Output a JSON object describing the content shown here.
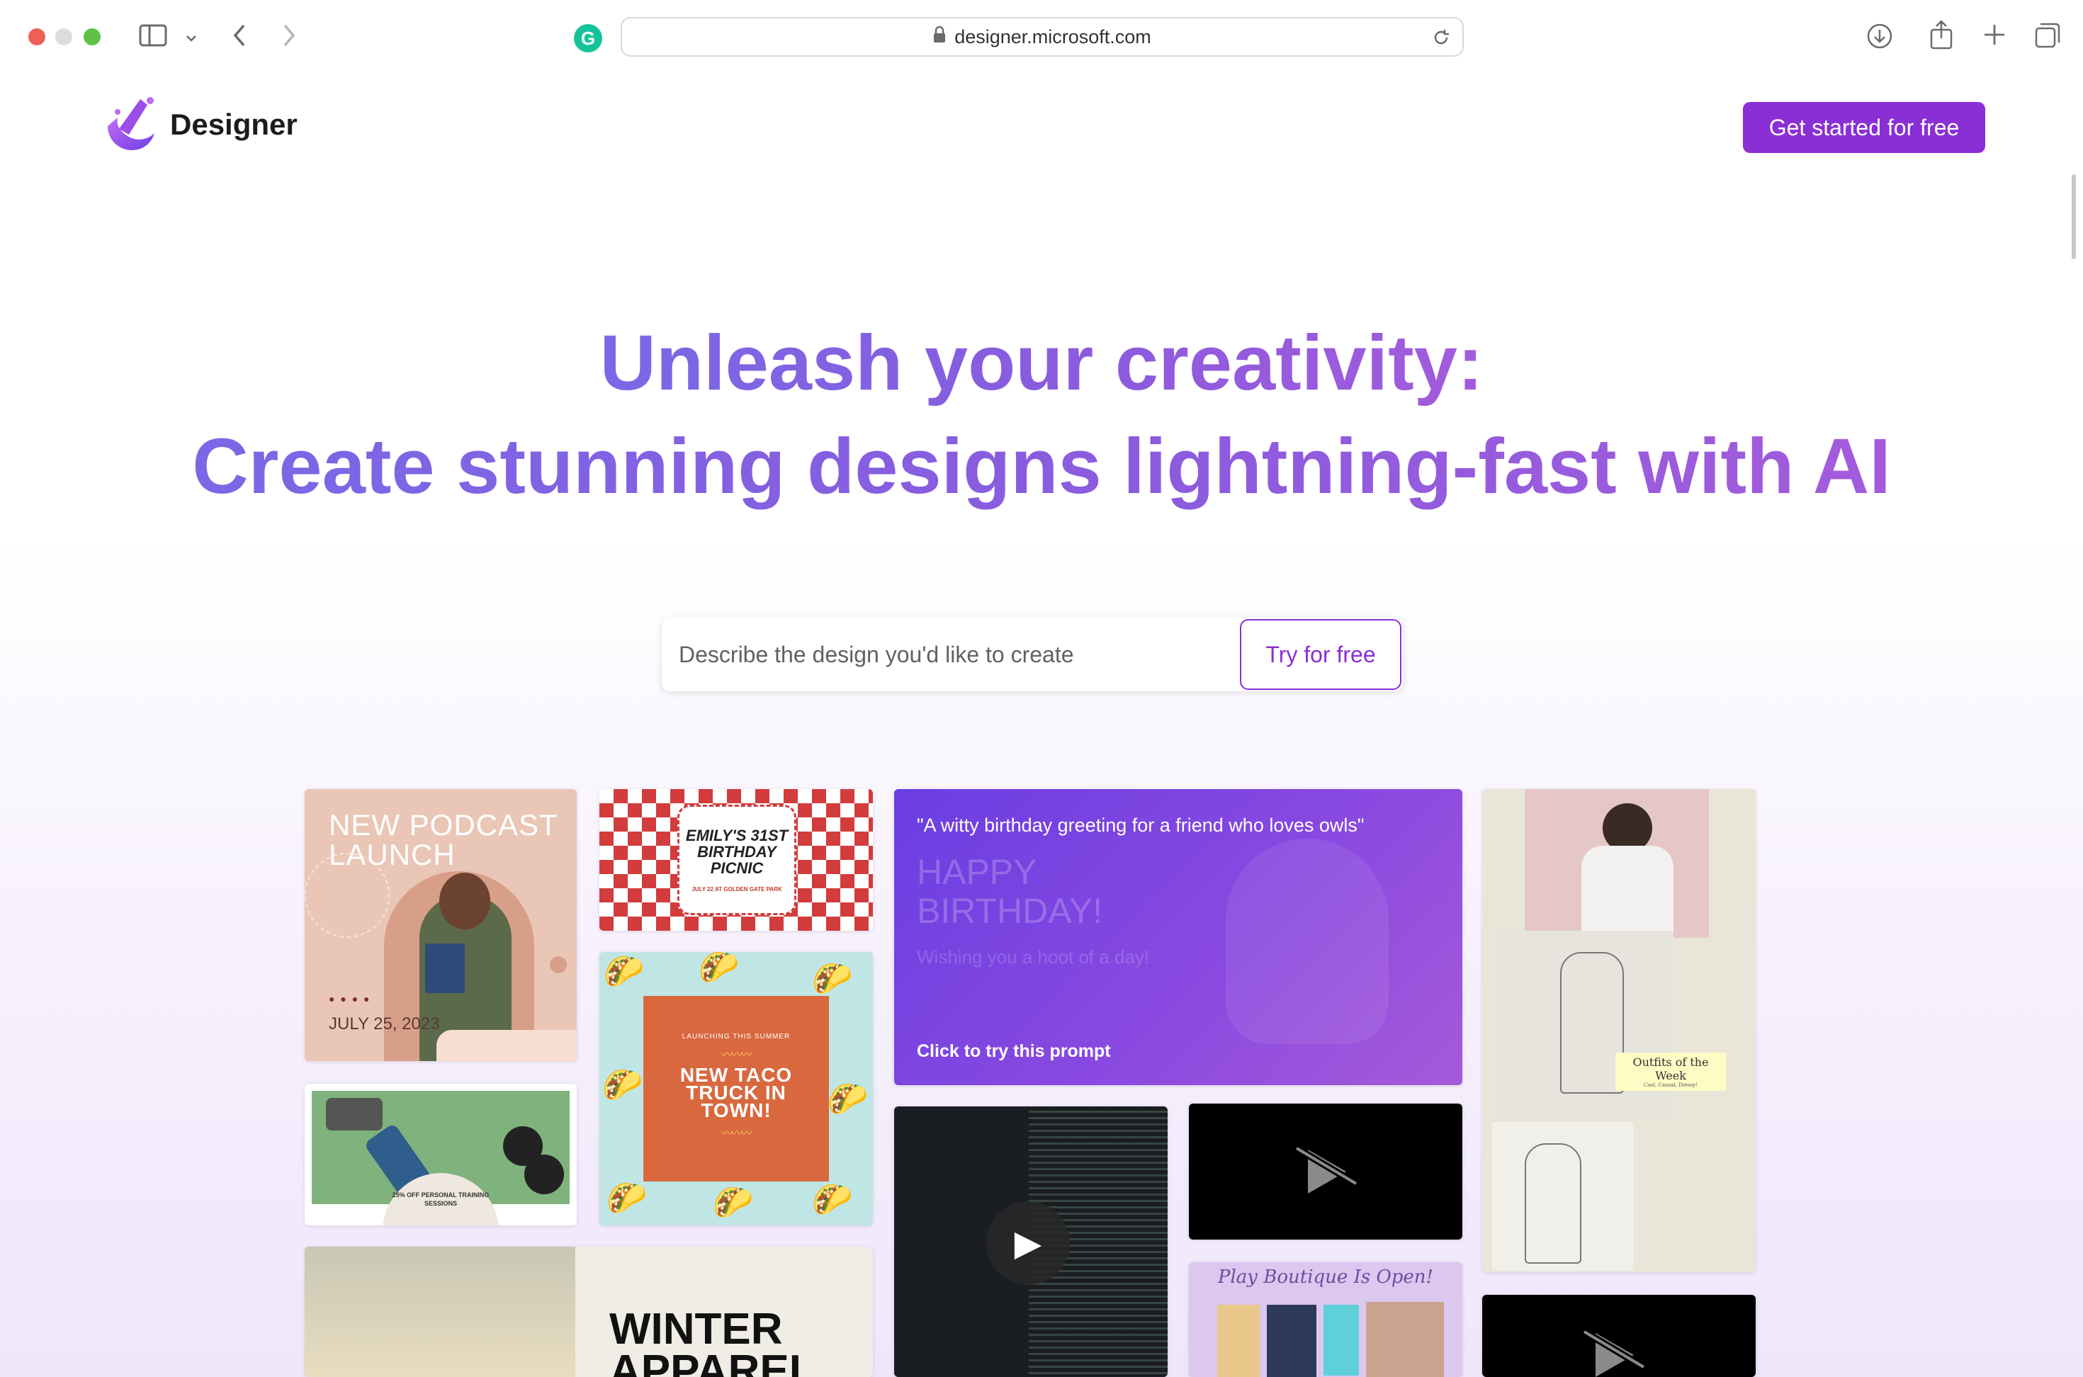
{
  "browser": {
    "url": "designer.microsoft.com",
    "icons": {
      "sidebar": "sidebar-icon",
      "back": "chevron-left-icon",
      "forward": "chevron-right-icon",
      "lock": "lock-icon",
      "reload": "reload-icon",
      "download": "download-icon",
      "share": "share-icon",
      "new_tab": "plus-icon",
      "tabs": "tabs-icon",
      "extension": "grammarly-icon"
    }
  },
  "header": {
    "brand": "Designer",
    "cta_label": "Get started for free"
  },
  "hero": {
    "line1": "Unleash your creativity:",
    "line2": "Create stunning designs lightning-fast with AI",
    "search_placeholder": "Describe the design you'd like to create",
    "try_label": "Try for free"
  },
  "gallery": {
    "podcast": {
      "title": "NEW PODCAST LAUNCH",
      "date": "JULY 25, 2023"
    },
    "picnic": {
      "title": "EMILY'S 31ST BIRTHDAY PICNIC",
      "subtitle": "JULY 22 AT GOLDEN GATE PARK"
    },
    "prompt": {
      "quote": "\"A witty birthday greeting for a friend who loves owls\"",
      "heading": "HAPPY BIRTHDAY!",
      "wish": "Wishing you a hoot of a day!",
      "cta": "Click to try this prompt"
    },
    "taco": {
      "kicker": "LAUNCHING THIS SUMMER",
      "title": "NEW TACO TRUCK IN TOWN!"
    },
    "fitness": {
      "text": "25% OFF PERSONAL TRAINING SESSIONS"
    },
    "fashion": {
      "label": "Outfits of the Week",
      "sublabel": "Cool, Casual, Dressy!"
    },
    "boutique": {
      "text": "Play Boutique Is Open!"
    },
    "winter": {
      "text": "WINTER APPAREL"
    }
  },
  "colors": {
    "brand_purple": "#8a2ed6",
    "headline_start": "#7a68e6",
    "headline_end": "#a35bdc"
  }
}
